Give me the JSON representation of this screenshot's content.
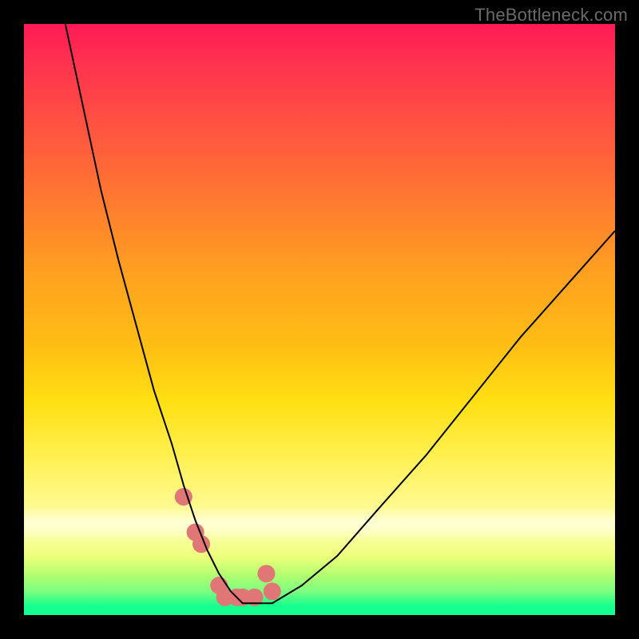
{
  "watermark": "TheBottleneck.com",
  "chart_data": {
    "type": "line",
    "title": "",
    "xlabel": "",
    "ylabel": "",
    "xlim": [
      0,
      100
    ],
    "ylim": [
      0,
      100
    ],
    "background_gradient": {
      "orientation": "vertical_top_to_bottom",
      "stops": [
        {
          "pos": 0,
          "color": "#ff1a56"
        },
        {
          "pos": 18,
          "color": "#ff5540"
        },
        {
          "pos": 42,
          "color": "#ffa020"
        },
        {
          "pos": 64,
          "color": "#ffe013"
        },
        {
          "pos": 86,
          "color": "#fcffa5"
        },
        {
          "pos": 96,
          "color": "#7dff80"
        },
        {
          "pos": 100,
          "color": "#14ff8f"
        }
      ]
    },
    "series": [
      {
        "name": "bottleneck-curve",
        "color": "#000000",
        "stroke_width": 2,
        "x": [
          7,
          10,
          13,
          16,
          19,
          22,
          25,
          27,
          29,
          31,
          33,
          35,
          37,
          42,
          47,
          53,
          60,
          68,
          76,
          84,
          92,
          100
        ],
        "y_value": [
          100,
          86,
          72,
          60,
          49,
          38,
          29,
          22,
          16,
          11,
          7,
          4,
          2,
          2,
          5,
          10,
          18,
          27,
          37,
          47,
          56,
          65
        ]
      },
      {
        "name": "highlight-dots",
        "color": "#e07676",
        "type": "scatter",
        "marker_radius_px": 11,
        "x": [
          27,
          30,
          33,
          36,
          39,
          42,
          34,
          37,
          41,
          29
        ],
        "y_value": [
          20,
          12,
          5,
          3,
          3,
          4,
          3,
          3,
          7,
          14
        ]
      }
    ],
    "notes": "y_value is plotted upward from the bottom of the plot area; values are approximate readings from the figure."
  }
}
